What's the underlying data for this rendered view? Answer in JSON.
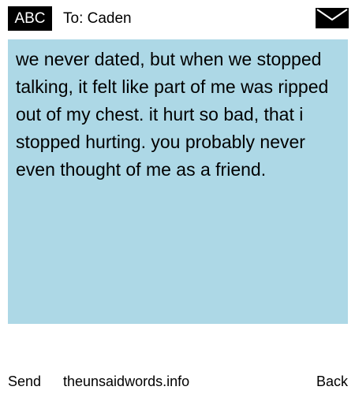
{
  "header": {
    "input_mode": "ABC",
    "recipient_line": "To: Caden",
    "envelope_icon": "envelope-icon"
  },
  "message": {
    "body": "we never dated, but when we stopped talking, it felt like part of me was ripped out of my chest. it hurt so bad, that i stopped hurting. you probably never even thought of me as a friend.",
    "background_color": "#add8e6"
  },
  "footer": {
    "send_label": "Send",
    "site": "theunsaidwords.info",
    "back_label": "Back"
  }
}
